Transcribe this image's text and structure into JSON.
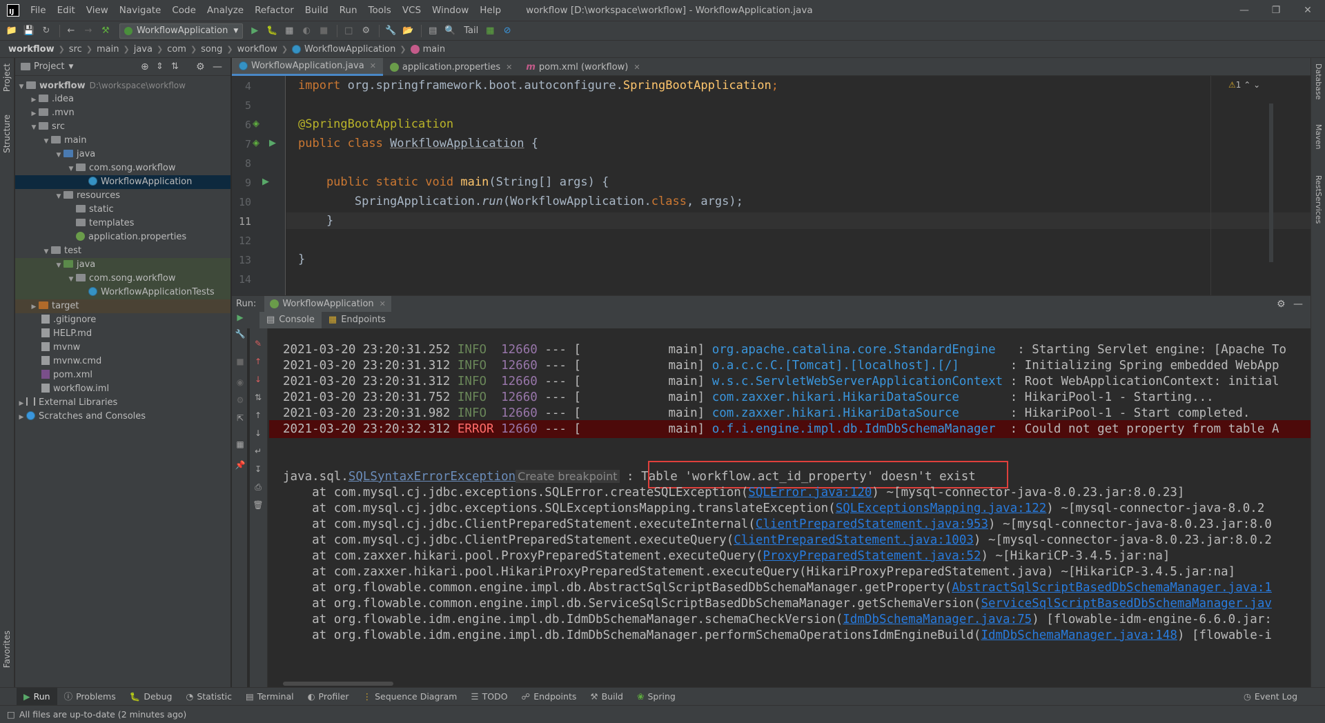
{
  "menubar": {
    "items": [
      "File",
      "Edit",
      "View",
      "Navigate",
      "Code",
      "Analyze",
      "Refactor",
      "Build",
      "Run",
      "Tools",
      "VCS",
      "Window",
      "Help"
    ],
    "window_title": "workflow [D:\\workspace\\workflow] - WorkflowApplication.java"
  },
  "toolbar": {
    "run_config": "WorkflowApplication",
    "tail_label": "Tail"
  },
  "breadcrumb": [
    "workflow",
    "src",
    "main",
    "java",
    "com",
    "song",
    "workflow",
    "WorkflowApplication",
    "main"
  ],
  "left_stripe": {
    "project": "Project",
    "structure": "Structure",
    "favorites": "Favorites"
  },
  "right_stripe": {
    "database": "Database",
    "maven": "Maven",
    "rest": "RestServices"
  },
  "project": {
    "header": "Project",
    "root_name": "workflow",
    "root_path": "D:\\workspace\\workflow",
    "items": [
      {
        "label": "workflow"
      },
      {
        "label": ".idea"
      },
      {
        "label": ".mvn"
      },
      {
        "label": "src"
      },
      {
        "label": "main"
      },
      {
        "label": "java"
      },
      {
        "label": "com.song.workflow"
      },
      {
        "label": "WorkflowApplication"
      },
      {
        "label": "resources"
      },
      {
        "label": "static"
      },
      {
        "label": "templates"
      },
      {
        "label": "application.properties"
      },
      {
        "label": "test"
      },
      {
        "label": "java"
      },
      {
        "label": "com.song.workflow"
      },
      {
        "label": "WorkflowApplicationTests"
      },
      {
        "label": "target"
      },
      {
        "label": ".gitignore"
      },
      {
        "label": "HELP.md"
      },
      {
        "label": "mvnw"
      },
      {
        "label": "mvnw.cmd"
      },
      {
        "label": "pom.xml"
      },
      {
        "label": "workflow.iml"
      },
      {
        "label": "External Libraries"
      },
      {
        "label": "Scratches and Consoles"
      }
    ]
  },
  "editor_tabs": [
    {
      "label": "WorkflowApplication.java"
    },
    {
      "label": "application.properties"
    },
    {
      "label": "pom.xml (workflow)"
    }
  ],
  "editor": {
    "warning_count": "1",
    "line_numbers": [
      "4",
      "5",
      "6",
      "7",
      "8",
      "9",
      "10",
      "11",
      "12",
      "13",
      "14"
    ],
    "code": {
      "l4_kw": "import",
      "l4_rest": " org.springframework.boot.autoconfigure.",
      "l4_cls": "SpringBootApplication",
      "l4_end": ";",
      "l6": "@SpringBootApplication",
      "l7_kw": "public class ",
      "l7_name": "WorkflowApplication",
      "l7_end": " {",
      "l9_kw": "    public static void ",
      "l9_fn": "main",
      "l9_rest": "(String[] args) {",
      "l10_a": "        SpringApplication.",
      "l10_b": "run",
      "l10_c": "(WorkflowApplication.",
      "l10_d": "class",
      "l10_e": ", args);",
      "l11": "    }",
      "l13": "}"
    }
  },
  "run_panel": {
    "run_label": "Run:",
    "config_tab": "WorkflowApplication",
    "subtabs": [
      "Console",
      "Endpoints"
    ]
  },
  "console": {
    "log_lines": [
      {
        "time": "2021-03-20 23:20:31.252",
        "level": "INFO",
        "pid": "12660",
        "sep": "--- [",
        "thread": "           main]",
        "logger": "org.apache.catalina.core.StandardEngine  ",
        "msg": ": Starting Servlet engine: [Apache To"
      },
      {
        "time": "2021-03-20 23:20:31.312",
        "level": "INFO",
        "pid": "12660",
        "sep": "--- [",
        "thread": "           main]",
        "logger": "o.a.c.c.C.[Tomcat].[localhost].[/]      ",
        "msg": ": Initializing Spring embedded WebApp"
      },
      {
        "time": "2021-03-20 23:20:31.312",
        "level": "INFO",
        "pid": "12660",
        "sep": "--- [",
        "thread": "           main]",
        "logger": "w.s.c.ServletWebServerApplicationContext",
        "msg": ": Root WebApplicationContext: initial"
      },
      {
        "time": "2021-03-20 23:20:31.752",
        "level": "INFO",
        "pid": "12660",
        "sep": "--- [",
        "thread": "           main]",
        "logger": "com.zaxxer.hikari.HikariDataSource      ",
        "msg": ": HikariPool-1 - Starting..."
      },
      {
        "time": "2021-03-20 23:20:31.982",
        "level": "INFO",
        "pid": "12660",
        "sep": "--- [",
        "thread": "           main]",
        "logger": "com.zaxxer.hikari.HikariDataSource      ",
        "msg": ": HikariPool-1 - Start completed."
      },
      {
        "time": "2021-03-20 23:20:32.312",
        "level": "ERROR",
        "pid": "12660",
        "sep": "--- [",
        "thread": "           main]",
        "logger": "o.f.i.engine.impl.db.IdmDbSchemaManager ",
        "msg": " : Could not get property from table A"
      }
    ],
    "exception_prefix": "java.sql.",
    "exception_class": "SQLSyntaxErrorException",
    "create_breakpoint": "Create breakpoint",
    "exception_colon": " : ",
    "exception_message": "Table 'workflow.act_id_property' doesn't exist",
    "stack": [
      {
        "pre": "    at com.mysql.cj.jdbc.exceptions.SQLError.createSQLException(",
        "link": "SQLError.java:120",
        "post": ") ~[mysql-connector-java-8.0.23.jar:8.0.23]"
      },
      {
        "pre": "    at com.mysql.cj.jdbc.exceptions.SQLExceptionsMapping.translateException(",
        "link": "SQLExceptionsMapping.java:122",
        "post": ") ~[mysql-connector-java-8.0.2"
      },
      {
        "pre": "    at com.mysql.cj.jdbc.ClientPreparedStatement.executeInternal(",
        "link": "ClientPreparedStatement.java:953",
        "post": ") ~[mysql-connector-java-8.0.23.jar:8.0"
      },
      {
        "pre": "    at com.mysql.cj.jdbc.ClientPreparedStatement.executeQuery(",
        "link": "ClientPreparedStatement.java:1003",
        "post": ") ~[mysql-connector-java-8.0.23.jar:8.0.2"
      },
      {
        "pre": "    at com.zaxxer.hikari.pool.ProxyPreparedStatement.executeQuery(",
        "link": "ProxyPreparedStatement.java:52",
        "post": ") ~[HikariCP-3.4.5.jar:na]"
      },
      {
        "pre": "    at com.zaxxer.hikari.pool.HikariProxyPreparedStatement.executeQuery(HikariProxyPreparedStatement.java) ~[HikariCP-3.4.5.jar:na]",
        "link": "",
        "post": ""
      },
      {
        "pre": "    at org.flowable.common.engine.impl.db.AbstractSqlScriptBasedDbSchemaManager.getProperty(",
        "link": "AbstractSqlScriptBasedDbSchemaManager.java:1",
        "post": ""
      },
      {
        "pre": "    at org.flowable.common.engine.impl.db.ServiceSqlScriptBasedDbSchemaManager.getSchemaVersion(",
        "link": "ServiceSqlScriptBasedDbSchemaManager.jav",
        "post": ""
      },
      {
        "pre": "    at org.flowable.idm.engine.impl.db.IdmDbSchemaManager.schemaCheckVersion(",
        "link": "IdmDbSchemaManager.java:75",
        "post": ") [flowable-idm-engine-6.6.0.jar:"
      },
      {
        "pre": "    at org.flowable.idm.engine.impl.db.IdmDbSchemaManager.performSchemaOperationsIdmEngineBuild(",
        "link": "IdmDbSchemaManager.java:148",
        "post": ") [flowable-i"
      }
    ]
  },
  "bottom_tabs": [
    "Run",
    "Problems",
    "Debug",
    "Statistic",
    "Terminal",
    "Profiler",
    "Sequence Diagram",
    "TODO",
    "Endpoints",
    "Build",
    "Spring"
  ],
  "event_log": "Event Log",
  "status": "All files are up-to-date (2 minutes ago)"
}
